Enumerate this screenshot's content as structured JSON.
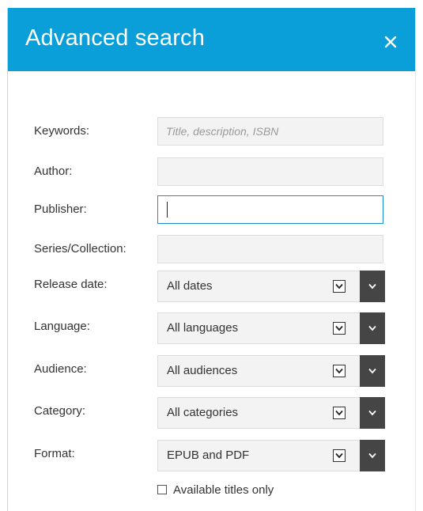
{
  "dialog": {
    "title": "Advanced search",
    "close_icon": "close-icon"
  },
  "fields": {
    "keywords": {
      "label": "Keywords:",
      "placeholder": "Title, description, ISBN",
      "value": ""
    },
    "author": {
      "label": "Author:",
      "placeholder": "",
      "value": ""
    },
    "publisher": {
      "label": "Publisher:",
      "placeholder": "",
      "value": ""
    },
    "series": {
      "label": "Series/Collection:",
      "placeholder": "",
      "value": ""
    }
  },
  "selects": {
    "release_date": {
      "label": "Release date:",
      "value": "All dates"
    },
    "language": {
      "label": "Language:",
      "value": "All languages"
    },
    "audience": {
      "label": "Audience:",
      "value": "All audiences"
    },
    "category": {
      "label": "Category:",
      "value": "All categories"
    },
    "format": {
      "label": "Format:",
      "value": "EPUB and PDF"
    }
  },
  "available_only": {
    "label": "Available titles only",
    "checked": false
  },
  "colors": {
    "header": "#0a9fd8",
    "dropdown_button": "#454545",
    "focus_border": "#1a8fc4"
  }
}
